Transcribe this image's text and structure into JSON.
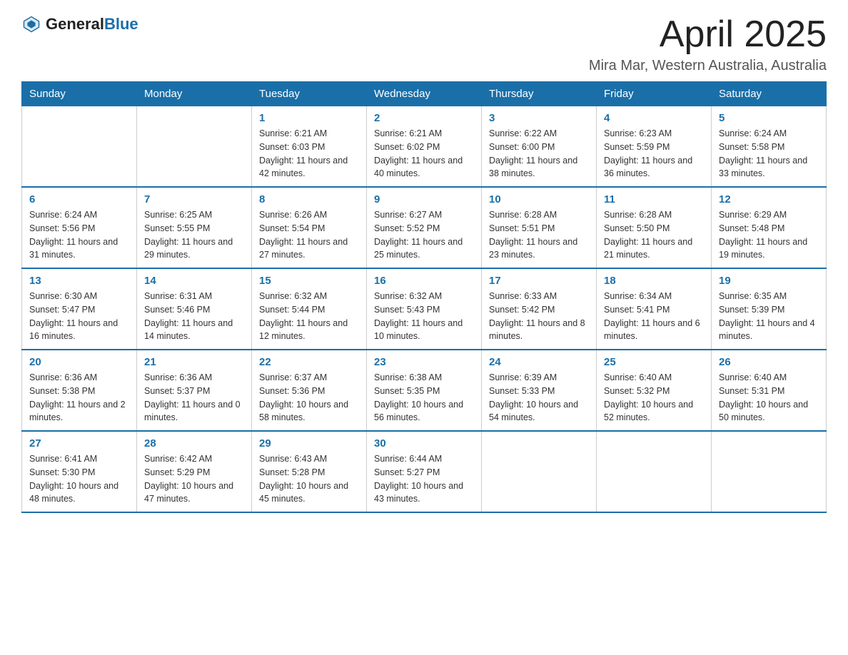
{
  "header": {
    "logo_general": "General",
    "logo_blue": "Blue",
    "month_year": "April 2025",
    "location": "Mira Mar, Western Australia, Australia"
  },
  "weekdays": [
    "Sunday",
    "Monday",
    "Tuesday",
    "Wednesday",
    "Thursday",
    "Friday",
    "Saturday"
  ],
  "weeks": [
    [
      {
        "day": "",
        "info": ""
      },
      {
        "day": "",
        "info": ""
      },
      {
        "day": "1",
        "info": "Sunrise: 6:21 AM\nSunset: 6:03 PM\nDaylight: 11 hours\nand 42 minutes."
      },
      {
        "day": "2",
        "info": "Sunrise: 6:21 AM\nSunset: 6:02 PM\nDaylight: 11 hours\nand 40 minutes."
      },
      {
        "day": "3",
        "info": "Sunrise: 6:22 AM\nSunset: 6:00 PM\nDaylight: 11 hours\nand 38 minutes."
      },
      {
        "day": "4",
        "info": "Sunrise: 6:23 AM\nSunset: 5:59 PM\nDaylight: 11 hours\nand 36 minutes."
      },
      {
        "day": "5",
        "info": "Sunrise: 6:24 AM\nSunset: 5:58 PM\nDaylight: 11 hours\nand 33 minutes."
      }
    ],
    [
      {
        "day": "6",
        "info": "Sunrise: 6:24 AM\nSunset: 5:56 PM\nDaylight: 11 hours\nand 31 minutes."
      },
      {
        "day": "7",
        "info": "Sunrise: 6:25 AM\nSunset: 5:55 PM\nDaylight: 11 hours\nand 29 minutes."
      },
      {
        "day": "8",
        "info": "Sunrise: 6:26 AM\nSunset: 5:54 PM\nDaylight: 11 hours\nand 27 minutes."
      },
      {
        "day": "9",
        "info": "Sunrise: 6:27 AM\nSunset: 5:52 PM\nDaylight: 11 hours\nand 25 minutes."
      },
      {
        "day": "10",
        "info": "Sunrise: 6:28 AM\nSunset: 5:51 PM\nDaylight: 11 hours\nand 23 minutes."
      },
      {
        "day": "11",
        "info": "Sunrise: 6:28 AM\nSunset: 5:50 PM\nDaylight: 11 hours\nand 21 minutes."
      },
      {
        "day": "12",
        "info": "Sunrise: 6:29 AM\nSunset: 5:48 PM\nDaylight: 11 hours\nand 19 minutes."
      }
    ],
    [
      {
        "day": "13",
        "info": "Sunrise: 6:30 AM\nSunset: 5:47 PM\nDaylight: 11 hours\nand 16 minutes."
      },
      {
        "day": "14",
        "info": "Sunrise: 6:31 AM\nSunset: 5:46 PM\nDaylight: 11 hours\nand 14 minutes."
      },
      {
        "day": "15",
        "info": "Sunrise: 6:32 AM\nSunset: 5:44 PM\nDaylight: 11 hours\nand 12 minutes."
      },
      {
        "day": "16",
        "info": "Sunrise: 6:32 AM\nSunset: 5:43 PM\nDaylight: 11 hours\nand 10 minutes."
      },
      {
        "day": "17",
        "info": "Sunrise: 6:33 AM\nSunset: 5:42 PM\nDaylight: 11 hours\nand 8 minutes."
      },
      {
        "day": "18",
        "info": "Sunrise: 6:34 AM\nSunset: 5:41 PM\nDaylight: 11 hours\nand 6 minutes."
      },
      {
        "day": "19",
        "info": "Sunrise: 6:35 AM\nSunset: 5:39 PM\nDaylight: 11 hours\nand 4 minutes."
      }
    ],
    [
      {
        "day": "20",
        "info": "Sunrise: 6:36 AM\nSunset: 5:38 PM\nDaylight: 11 hours\nand 2 minutes."
      },
      {
        "day": "21",
        "info": "Sunrise: 6:36 AM\nSunset: 5:37 PM\nDaylight: 11 hours\nand 0 minutes."
      },
      {
        "day": "22",
        "info": "Sunrise: 6:37 AM\nSunset: 5:36 PM\nDaylight: 10 hours\nand 58 minutes."
      },
      {
        "day": "23",
        "info": "Sunrise: 6:38 AM\nSunset: 5:35 PM\nDaylight: 10 hours\nand 56 minutes."
      },
      {
        "day": "24",
        "info": "Sunrise: 6:39 AM\nSunset: 5:33 PM\nDaylight: 10 hours\nand 54 minutes."
      },
      {
        "day": "25",
        "info": "Sunrise: 6:40 AM\nSunset: 5:32 PM\nDaylight: 10 hours\nand 52 minutes."
      },
      {
        "day": "26",
        "info": "Sunrise: 6:40 AM\nSunset: 5:31 PM\nDaylight: 10 hours\nand 50 minutes."
      }
    ],
    [
      {
        "day": "27",
        "info": "Sunrise: 6:41 AM\nSunset: 5:30 PM\nDaylight: 10 hours\nand 48 minutes."
      },
      {
        "day": "28",
        "info": "Sunrise: 6:42 AM\nSunset: 5:29 PM\nDaylight: 10 hours\nand 47 minutes."
      },
      {
        "day": "29",
        "info": "Sunrise: 6:43 AM\nSunset: 5:28 PM\nDaylight: 10 hours\nand 45 minutes."
      },
      {
        "day": "30",
        "info": "Sunrise: 6:44 AM\nSunset: 5:27 PM\nDaylight: 10 hours\nand 43 minutes."
      },
      {
        "day": "",
        "info": ""
      },
      {
        "day": "",
        "info": ""
      },
      {
        "day": "",
        "info": ""
      }
    ]
  ]
}
